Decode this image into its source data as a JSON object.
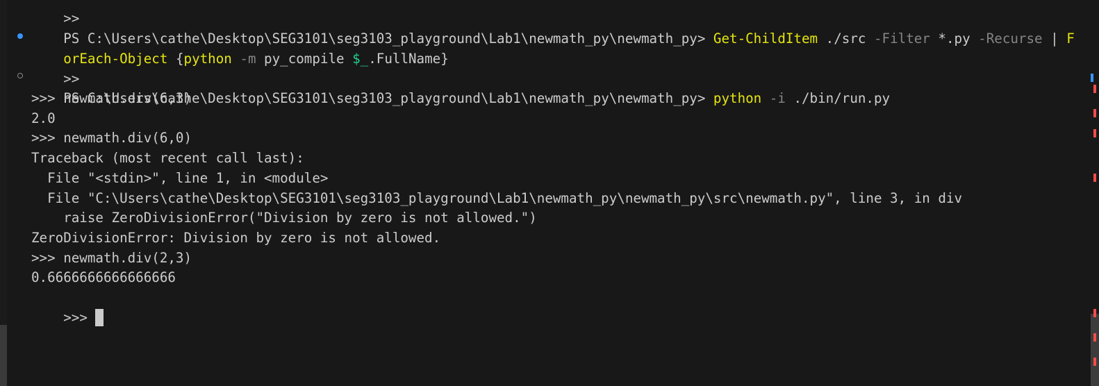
{
  "terminal": {
    "colors": {
      "background": "#181818",
      "text": "#cccccc",
      "command": "#e5e510",
      "parameter": "#858585",
      "variable": "#23d18b",
      "success_dot": "#3794ff",
      "error_marker": "#f14c4c",
      "info_marker": "#3794ff"
    },
    "line0": {
      "text": ">>"
    },
    "line1": {
      "prompt": "PS C:\\Users\\cathe\\Desktop\\SEG3101\\seg3103_playground\\Lab1\\newmath_py\\newmath_py> ",
      "cmd": "Get-ChildItem",
      "arg1": " ./src ",
      "param1": "-Filter",
      "arg2": " *.py ",
      "param2": "-Recurse",
      "pipe": " | ",
      "cmd2a": "F"
    },
    "line2": {
      "cmd2b": "orEach-Object",
      "brace_open": " {",
      "cmd3": "python",
      "space": " ",
      "param3": "-m",
      "arg3": " py_compile ",
      "var": "$_",
      "arg4": ".FullName}"
    },
    "line3": {
      "text": ">>"
    },
    "line4": {
      "prompt": "PS C:\\Users\\cathe\\Desktop\\SEG3101\\seg3103_playground\\Lab1\\newmath_py\\newmath_py> ",
      "cmd": "python",
      "space": " ",
      "param": "-i",
      "arg": " ./bin/run.py"
    },
    "output": [
      ">>> newmath.div(6,3)",
      "2.0",
      ">>> newmath.div(6,0)",
      "Traceback (most recent call last):",
      "  File \"<stdin>\", line 1, in <module>",
      "  File \"C:\\Users\\cathe\\Desktop\\SEG3101\\seg3103_playground\\Lab1\\newmath_py\\newmath_py\\src\\newmath.py\", line 3, in div",
      "    raise ZeroDivisionError(\"Division by zero is not allowed.\")",
      "ZeroDivisionError: Division by zero is not allowed.",
      ">>> newmath.div(2,3)",
      "0.6666666666666666"
    ],
    "final_prompt": ">>> "
  }
}
